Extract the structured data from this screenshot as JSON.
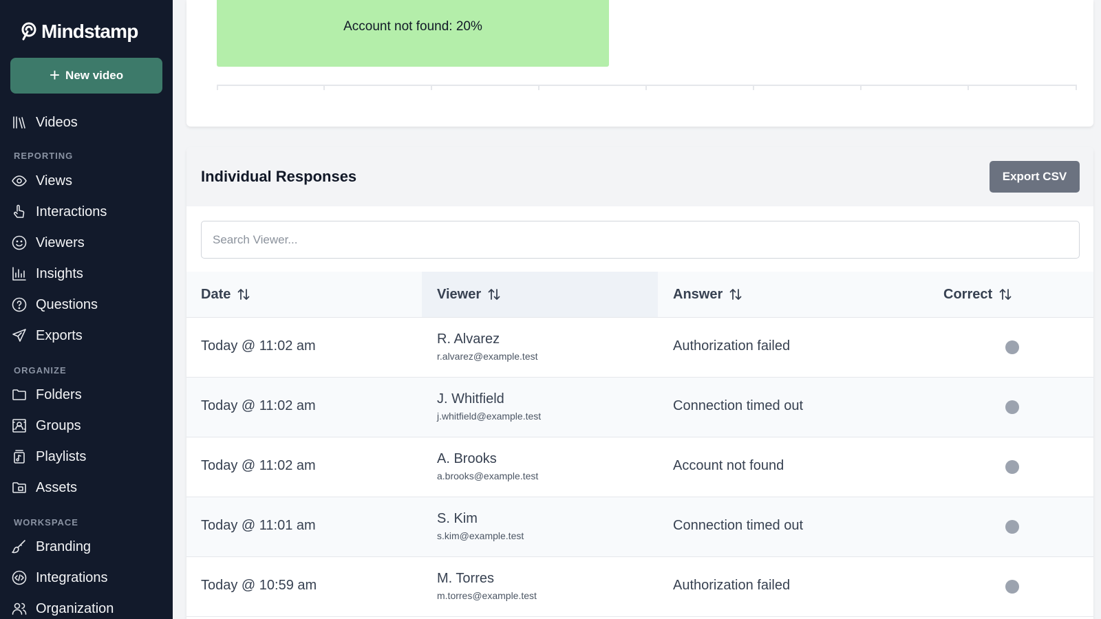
{
  "app": {
    "name": "Mindstamp",
    "new_video_label": "New video"
  },
  "sidebar": {
    "top_item": {
      "label": "Videos",
      "icon": "library-icon"
    },
    "sections": [
      {
        "label": "REPORTING",
        "items": [
          {
            "label": "Views",
            "icon": "eye-icon"
          },
          {
            "label": "Interactions",
            "icon": "pointer-hand-icon"
          },
          {
            "label": "Viewers",
            "icon": "smile-face-icon"
          },
          {
            "label": "Insights",
            "icon": "bar-chart-icon"
          },
          {
            "label": "Questions",
            "icon": "question-circle-icon"
          },
          {
            "label": "Exports",
            "icon": "send-icon"
          }
        ]
      },
      {
        "label": "ORGANIZE",
        "items": [
          {
            "label": "Folders",
            "icon": "folder-icon"
          },
          {
            "label": "Groups",
            "icon": "group-frame-icon"
          },
          {
            "label": "Playlists",
            "icon": "playlist-icon"
          },
          {
            "label": "Assets",
            "icon": "assets-folder-icon"
          }
        ]
      },
      {
        "label": "WORKSPACE",
        "items": [
          {
            "label": "Branding",
            "icon": "paintbrush-icon"
          },
          {
            "label": "Integrations",
            "icon": "code-circle-icon"
          },
          {
            "label": "Organization",
            "icon": "users-icon"
          }
        ]
      }
    ]
  },
  "chart": {
    "bar_label": "Account not found: 20%",
    "bar_color": "#b4eeaa"
  },
  "responses": {
    "title": "Individual Responses",
    "export_label": "Export CSV",
    "search_placeholder": "Search Viewer...",
    "columns": [
      "Date",
      "Viewer",
      "Answer",
      "Correct"
    ],
    "rows": [
      {
        "date": "Today @ 11:02 am",
        "name": "R. Alvarez",
        "email": "r.alvarez@example.test",
        "answer": "Authorization failed"
      },
      {
        "date": "Today @ 11:02 am",
        "name": "J. Whitfield",
        "email": "j.whitfield@example.test",
        "answer": "Connection timed out"
      },
      {
        "date": "Today @ 11:02 am",
        "name": "A. Brooks",
        "email": "a.brooks@example.test",
        "answer": "Account not found"
      },
      {
        "date": "Today @ 11:01 am",
        "name": "S. Kim",
        "email": "s.kim@example.test",
        "answer": "Connection timed out"
      },
      {
        "date": "Today @ 10:59 am",
        "name": "M. Torres",
        "email": "m.torres@example.test",
        "answer": "Authorization failed"
      }
    ]
  },
  "colors": {
    "sidebar_bg": "#121a2b",
    "accent": "#3d7a6a",
    "neutral_dot": "#9ca3af"
  }
}
